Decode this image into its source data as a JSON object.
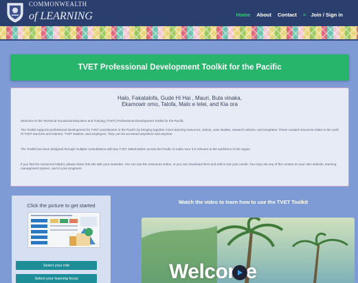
{
  "header": {
    "logo_line1": "COMMONWEALTH",
    "logo_line2": "of LEARNING",
    "nav": {
      "home": "Home",
      "about": "About",
      "contact": "Contact",
      "separator": "=",
      "join": "Join / Sign in"
    }
  },
  "banner": {
    "title": "TVET Professional Development Toolkit for the Pacific"
  },
  "intro": {
    "greeting_line1": "Halo, Fakatalofa, Gude Hi Hai , Mauri, Bula vinaka,",
    "greeting_line2": "Ekamowir omo, Talofa, Malo e lelei, and Kia ora",
    "paragraphs": [
      "Welcome to the Technical Vocational Education and Training (TVET) Professional Development Toolkit for the Pacific",
      "The Toolkit supports professional development for TVET practitioners in the Pacific by bringing together micro-learning resources, videos, case studies, research articles, and templates. These curated resources relate to the work of TVET teachers and trainers, TVET leaders, and employers. They can be accessed anywhere and anytime.",
      "The Toolkit has been designed through multiple consultations with key TVET stakeholders across the Pacific to make sure it is relevant to the workforce in the region.",
      "If you find the resources helpful, please share this site with your networks. You can use the resources online, or you can download them and edit to suit your needs. You may use any of the content on your own website, learning management system, and in your programs."
    ]
  },
  "start_card": {
    "title": "Click the picture to get started",
    "buttons": [
      "Select your role",
      "Select your learning focus"
    ]
  },
  "video": {
    "title": "Watch the video to learn how to use the TVET Toolkit",
    "overlay_text": "Welcome"
  },
  "colors": {
    "header_bg": "#2b3f6e",
    "page_bg": "#7e9bd6",
    "banner_green": "#26b56a",
    "nav_active": "#37c77a",
    "button_teal": "#1d8d98"
  }
}
